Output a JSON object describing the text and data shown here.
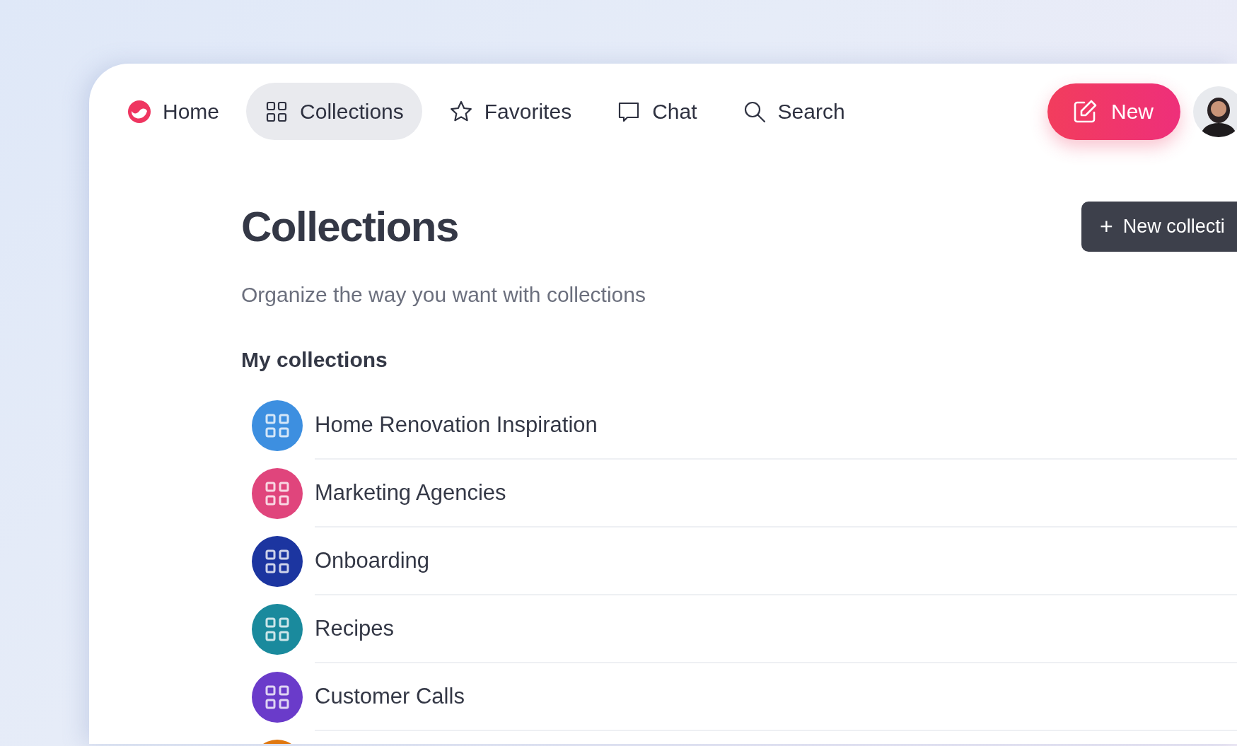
{
  "nav": {
    "items": [
      {
        "kind": "home",
        "label": "Home",
        "selected": false
      },
      {
        "kind": "collections",
        "label": "Collections",
        "selected": true
      },
      {
        "kind": "favorites",
        "label": "Favorites",
        "selected": false
      },
      {
        "kind": "chat",
        "label": "Chat",
        "selected": false
      },
      {
        "kind": "search",
        "label": "Search",
        "selected": false
      }
    ],
    "new_button": {
      "label": "New"
    }
  },
  "page": {
    "title": "Collections",
    "new_collection_button": {
      "icon": "+",
      "label": "New collecti"
    },
    "subtitle": "Organize the way you want with collections",
    "section_title": "My collections",
    "collections": [
      {
        "name": "Home Renovation Inspiration",
        "color": "#3d8fe0"
      },
      {
        "name": "Marketing Agencies",
        "color": "#e0457c"
      },
      {
        "name": "Onboarding",
        "color": "#1c35a0"
      },
      {
        "name": "Recipes",
        "color": "#1a8a9d"
      },
      {
        "name": "Customer Calls",
        "color": "#6a3bca"
      },
      {
        "color": "#e07810"
      }
    ]
  }
}
